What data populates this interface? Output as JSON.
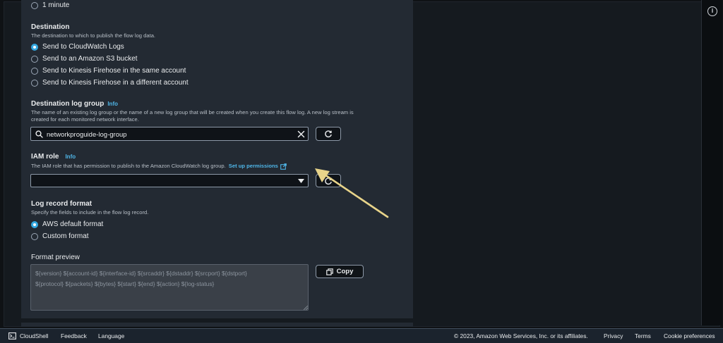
{
  "interval": {
    "option_1min": "1 minute"
  },
  "destination": {
    "label": "Destination",
    "description": "The destination to which to publish the flow log data.",
    "options": [
      {
        "label": "Send to CloudWatch Logs",
        "checked": true
      },
      {
        "label": "Send to an Amazon S3 bucket",
        "checked": false
      },
      {
        "label": "Send to Kinesis Firehose in the same account",
        "checked": false
      },
      {
        "label": "Send to Kinesis Firehose in a different account",
        "checked": false
      }
    ]
  },
  "log_group": {
    "label": "Destination log group",
    "info": "Info",
    "description_line1": "The name of an existing log group or the name of a new log group that will be created when you create this flow log. A new log stream is",
    "description_line2": "created for each monitored network interface.",
    "value": "networkproguide-log-group"
  },
  "iam_role": {
    "label": "IAM role",
    "info": "Info",
    "description": "The IAM role that has permission to publish to the Amazon CloudWatch log group.",
    "setup_link": "Set up permissions",
    "value": ""
  },
  "log_format": {
    "label": "Log record format",
    "description": "Specify the fields to include in the flow log record.",
    "options": [
      {
        "label": "AWS default format",
        "checked": true
      },
      {
        "label": "Custom format",
        "checked": false
      }
    ]
  },
  "format_preview": {
    "label": "Format preview",
    "line1": "${version} ${account-id} ${interface-id} ${srcaddr} ${dstaddr} ${srcport} ${dstport}",
    "line2": "${protocol} ${packets} ${bytes} ${start} ${end} ${action} ${log-status}",
    "copy_label": "Copy"
  },
  "footer": {
    "cloudshell": "CloudShell",
    "feedback": "Feedback",
    "language": "Language",
    "copyright": "© 2023, Amazon Web Services, Inc. or its affiliates.",
    "privacy": "Privacy",
    "terms": "Terms",
    "cookies": "Cookie preferences"
  },
  "colors": {
    "accent": "#33a7e0",
    "link": "#4fb6e8",
    "annotation_arrow": "#e8d48a"
  }
}
